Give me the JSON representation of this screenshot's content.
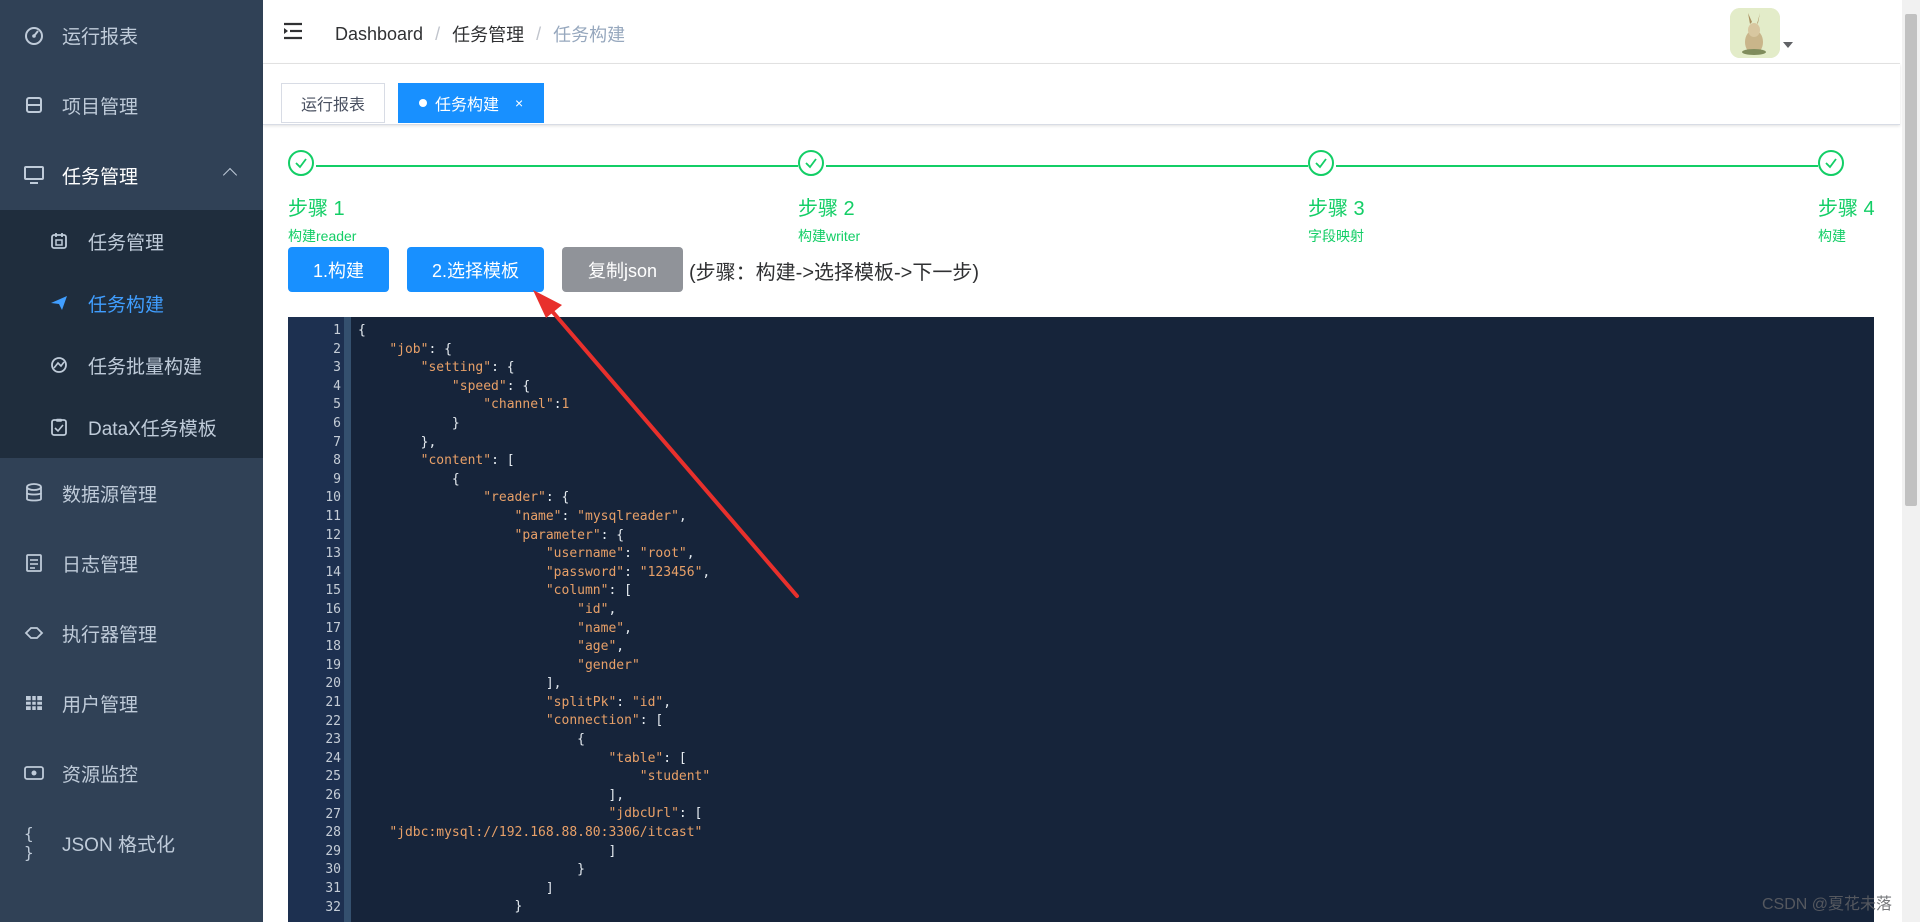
{
  "sidebar": {
    "items": [
      {
        "label": "运行报表",
        "icon": "dashboard-icon"
      },
      {
        "label": "项目管理",
        "icon": "database-icon"
      },
      {
        "label": "任务管理",
        "icon": "monitor-icon",
        "expanded": true
      },
      {
        "label": "数据源管理",
        "icon": "datasource-icon"
      },
      {
        "label": "日志管理",
        "icon": "log-icon"
      },
      {
        "label": "执行器管理",
        "icon": "executor-icon"
      },
      {
        "label": "用户管理",
        "icon": "table-grid-icon"
      },
      {
        "label": "资源监控",
        "icon": "monitor-resource-icon"
      },
      {
        "label": "JSON 格式化",
        "icon": "braces-icon"
      }
    ],
    "sub_items": [
      {
        "label": "任务管理",
        "icon": "calendar-icon"
      },
      {
        "label": "任务构建",
        "icon": "paper-plane-icon",
        "active": true
      },
      {
        "label": "任务批量构建",
        "icon": "chart-circle-icon"
      },
      {
        "label": "DataX任务模板",
        "icon": "clipboard-icon"
      }
    ]
  },
  "header": {
    "breadcrumb": [
      "Dashboard",
      "任务管理",
      "任务构建"
    ],
    "separator": "/"
  },
  "tags": [
    {
      "label": "运行报表",
      "active": false
    },
    {
      "label": "任务构建",
      "active": true,
      "close": "×"
    }
  ],
  "steps": [
    {
      "title": "步骤 1",
      "desc": "构建reader"
    },
    {
      "title": "步骤 2",
      "desc": "构建writer"
    },
    {
      "title": "步骤 3",
      "desc": "字段映射"
    },
    {
      "title": "步骤 4",
      "desc": "构建"
    }
  ],
  "buttons": {
    "build": "1.构建",
    "choose_template": "2.选择模板",
    "copy_json": "复制json",
    "hint": "(步骤：构建->选择模板->下一步)"
  },
  "code_lines": [
    "{",
    "    \"job\": {",
    "        \"setting\": {",
    "            \"speed\": {",
    "                \"channel\":1",
    "            }",
    "        },",
    "        \"content\": [",
    "            {",
    "                \"reader\": {",
    "                    \"name\": \"mysqlreader\",",
    "                    \"parameter\": {",
    "                        \"username\": \"root\",",
    "                        \"password\": \"123456\",",
    "                        \"column\": [",
    "                            \"id\",",
    "                            \"name\",",
    "                            \"age\",",
    "                            \"gender\"",
    "                        ],",
    "                        \"splitPk\": \"id\",",
    "                        \"connection\": [",
    "                            {",
    "                                \"table\": [",
    "                                    \"student\"",
    "                                ],",
    "                                \"jdbcUrl\": [",
    "    \"jdbc:mysql://192.168.88.80:3306/itcast\"",
    "                                ]",
    "                            }",
    "                        ]",
    "                    }"
  ],
  "watermark": "CSDN @夏花未落",
  "colors": {
    "sidebar_bg": "#304156",
    "submenu_bg": "#1f2d3d",
    "primary": "#1890ff",
    "success": "#13ce66",
    "editor_bg": "#16243a",
    "annotation_arrow": "#e8302c"
  }
}
